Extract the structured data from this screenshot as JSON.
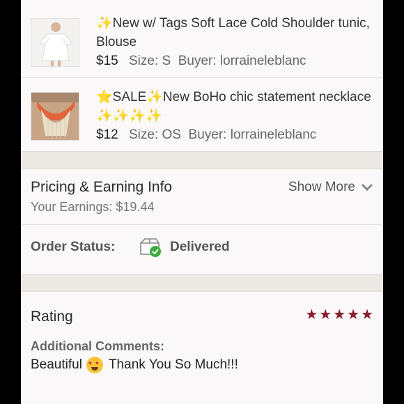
{
  "items": [
    {
      "title_prefix": "✨",
      "title": "New w/ Tags Soft Lace Cold Shoulder tunic, Blouse",
      "price": "$15",
      "size": "Size: S",
      "buyer": "Buyer: lorraineleblanc"
    },
    {
      "title_prefix": "⭐",
      "title": "SALE✨New BoHo chic statement necklace ✨✨✨✨",
      "price": "$12",
      "size": "Size: OS",
      "buyer": "Buyer: lorraineleblanc"
    }
  ],
  "pricing": {
    "heading": "Pricing & Earning Info",
    "earnings": "Your Earnings: $19.44",
    "show_more": "Show More"
  },
  "order": {
    "label": "Order Status:",
    "status": "Delivered",
    "icon": "package-delivered-icon",
    "status_color": "#3dac3d"
  },
  "rating": {
    "heading": "Rating",
    "stars": 5,
    "star_color": "#8b1e2b",
    "comments_label": "Additional Comments:",
    "comment_before": "Beautiful",
    "comment_after": "Thank You So Much!!!"
  }
}
